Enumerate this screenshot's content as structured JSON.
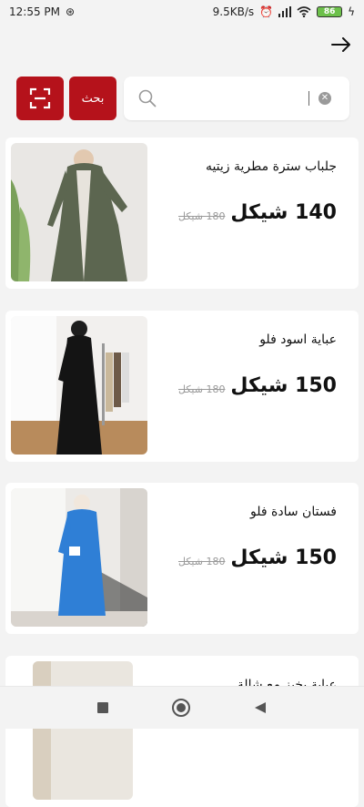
{
  "status": {
    "time": "12:55 PM",
    "network_speed": "9.5KB/s",
    "battery_level": "86",
    "icons": [
      "sync-icon",
      "alarm-icon",
      "signal-icon",
      "wifi-icon",
      "battery-icon",
      "charging-icon"
    ]
  },
  "header": {
    "back_icon": "arrow-right-icon"
  },
  "search": {
    "scan_icon": "scan-icon",
    "button_label": "بحث",
    "value": "",
    "search_icon": "search-icon",
    "clear_icon": "close-circle-icon"
  },
  "products": [
    {
      "title": "جلباب سترة مطرية زيتيه",
      "price": "140 شيكل",
      "old_price": "180 شيكل"
    },
    {
      "title": "عباية اسود فلو",
      "price": "150 شيكل",
      "old_price": "180 شيكل"
    },
    {
      "title": "فستان سادة فلو",
      "price": "150 شيكل",
      "old_price": "180 شيكل"
    },
    {
      "title": "عباية بخيز مع شالة",
      "price": "",
      "old_price": ""
    }
  ],
  "nav": {
    "icons": [
      "recent-apps-icon",
      "home-icon",
      "back-icon"
    ]
  },
  "colors": {
    "accent": "#b5121b",
    "background": "#f3f3f3"
  }
}
